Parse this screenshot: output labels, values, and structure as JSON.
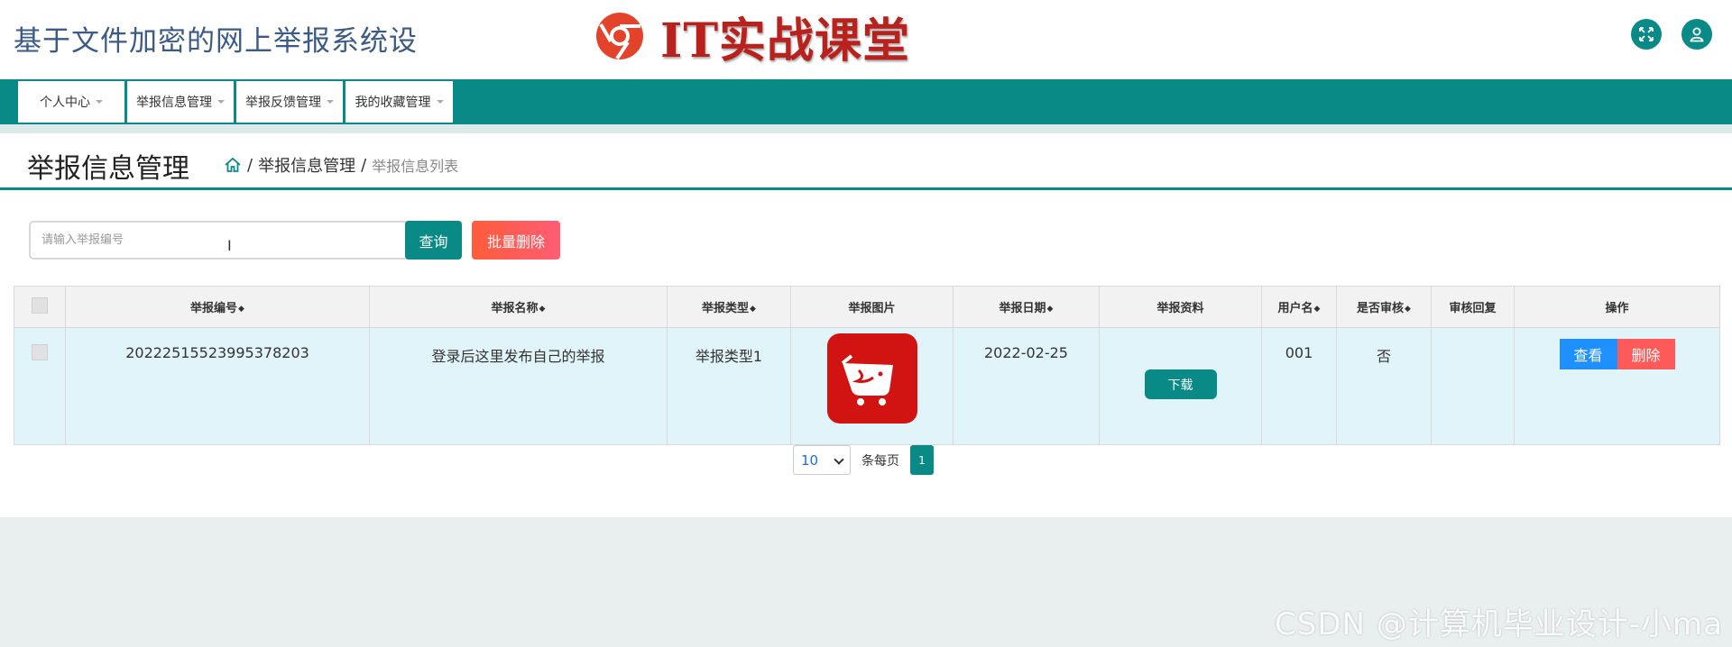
{
  "header": {
    "app_title": "基于文件加密的网上举报系统设",
    "brand_text": "IT实战课堂",
    "fullscreen_icon": "expand-icon",
    "user_icon": "user-icon"
  },
  "nav": {
    "items": [
      {
        "label": "个人中心"
      },
      {
        "label": "举报信息管理"
      },
      {
        "label": "举报反馈管理"
      },
      {
        "label": "我的收藏管理"
      }
    ]
  },
  "page": {
    "title": "举报信息管理",
    "breadcrumb": {
      "home_icon": "home-icon",
      "sep": "/",
      "level1": "举报信息管理",
      "level2": "举报信息列表"
    }
  },
  "toolbar": {
    "search_placeholder": "请输入举报编号",
    "search_value": "",
    "query_label": "查询",
    "batch_delete_label": "批量删除"
  },
  "table": {
    "columns": [
      "举报编号",
      "举报名称",
      "举报类型",
      "举报图片",
      "举报日期",
      "举报资料",
      "用户名",
      "是否审核",
      "审核回复",
      "操作"
    ],
    "sort_glyph": "◆",
    "rows": [
      {
        "report_no": "20222515523995378203",
        "report_name": "登录后这里发布自己的举报",
        "report_type": "举报类型1",
        "image_icon": "app-logo-image",
        "report_date": "2022-02-25",
        "download_label": "下载",
        "username": "001",
        "reviewed": "否",
        "review_reply": "",
        "view_label": "查看",
        "delete_label": "删除"
      }
    ]
  },
  "pagination": {
    "page_size": "10",
    "per_page_label": "条每页",
    "current_page": "1"
  },
  "watermark": "CSDN @计算机毕业设计-小ma",
  "colors": {
    "primary": "#0a8a86",
    "view": "#1e90ff",
    "danger": "#ff5a5a",
    "row_bg": "#e1f4fa"
  }
}
